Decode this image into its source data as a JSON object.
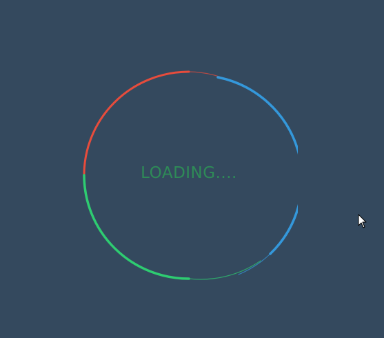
{
  "loader": {
    "text": "LOADING....",
    "text_color": "#2e8b57",
    "arc_colors": [
      "#e74c3c",
      "#3498db",
      "#2ecc71"
    ]
  },
  "background_color": "#34495e",
  "cursor": {
    "icon": "mouse-pointer-icon"
  }
}
